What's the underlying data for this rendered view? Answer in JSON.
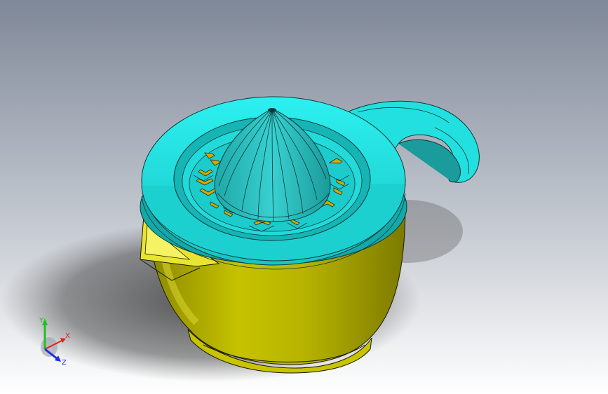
{
  "viewport": {
    "background_top": "#7f8898",
    "background_bottom": "#ffffff"
  },
  "model": {
    "body_color": "#c8c400",
    "body_shade": "#9c9a00",
    "lid_color": "#22e2e2",
    "lid_shade": "#10a8a8",
    "reamer_color": "#2cc8c8",
    "slot_color": "#d6a800",
    "edge_color": "#1a3a3a"
  },
  "triad": {
    "x_label": "X",
    "y_label": "Y",
    "z_label": "Z",
    "x_color": "#e02020",
    "y_color": "#20c020",
    "z_color": "#2030e0"
  }
}
